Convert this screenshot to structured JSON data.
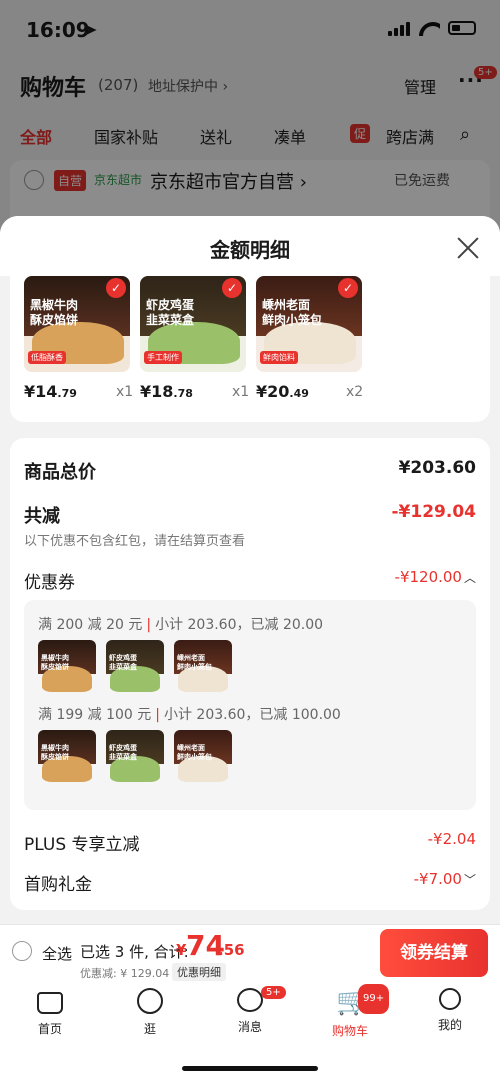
{
  "status": {
    "time": "16:09"
  },
  "background": {
    "title": "购物车",
    "count": "(207)",
    "address_protect": "地址保护中 ›",
    "manage": "管理",
    "more_badge": "5+",
    "tabs": [
      "全部",
      "国家补贴",
      "送礼",
      "凑单",
      "跨店满"
    ],
    "promo_tag": "促",
    "store_tag": "自营",
    "store_brand": "京东超市",
    "store_name": "京东超市官方自营 ›",
    "free_ship": "已免运费"
  },
  "sheet": {
    "title": "金额明细",
    "items": [
      {
        "name_line1": "黑椒牛肉",
        "name_line2": "酥皮馅饼",
        "tag": "低脂酥香",
        "price_int": "¥14",
        "price_dec": ".79",
        "qty": "x1"
      },
      {
        "name_line1": "虾皮鸡蛋",
        "name_line2": "韭菜菜盒",
        "tag": "手工制作",
        "price_int": "¥18",
        "price_dec": ".78",
        "qty": "x1"
      },
      {
        "name_line1": "嵊州老面",
        "name_line2": "鲜肉小笼包",
        "tag": "鲜肉馅料",
        "price_int": "¥20",
        "price_dec": ".49",
        "qty": "x2"
      }
    ],
    "goods_total_label": "商品总价",
    "goods_total_value": "¥203.60",
    "reduce_label": "共减",
    "reduce_value": "-¥129.04",
    "reduce_note": "以下优惠不包含红包，请在结算页查看",
    "coupon_label": "优惠券",
    "coupon_value": "-¥120.00",
    "coupon_groups": [
      {
        "rule": "满 200 减 20 元",
        "subtotal": "小计 203.60，已减 20.00"
      },
      {
        "rule": "满 199 减 100 元",
        "subtotal": "小计 203.60，已减 100.00"
      }
    ],
    "plus_label": "PLUS 专享立减",
    "plus_value": "-¥2.04",
    "first_gift_label": "首购礼金",
    "first_gift_value": "-¥7.00"
  },
  "checkout": {
    "select_all": "全选",
    "selected": "已选 3 件, 合计:",
    "currency": "¥",
    "total_int": "74",
    "total_dec": ".56",
    "discount": "优惠减: ¥ 129.04",
    "detail_link": "优惠明细",
    "pay_button": "领券结算"
  },
  "tabbar": [
    {
      "label": "首页",
      "badge": ""
    },
    {
      "label": "逛",
      "badge": ""
    },
    {
      "label": "消息",
      "badge": "5+"
    },
    {
      "label": "购物车",
      "badge": "99+"
    },
    {
      "label": "我的",
      "badge": ""
    }
  ],
  "colors": {
    "accent": "#e8322e",
    "store_green": "#2b9a4a"
  }
}
